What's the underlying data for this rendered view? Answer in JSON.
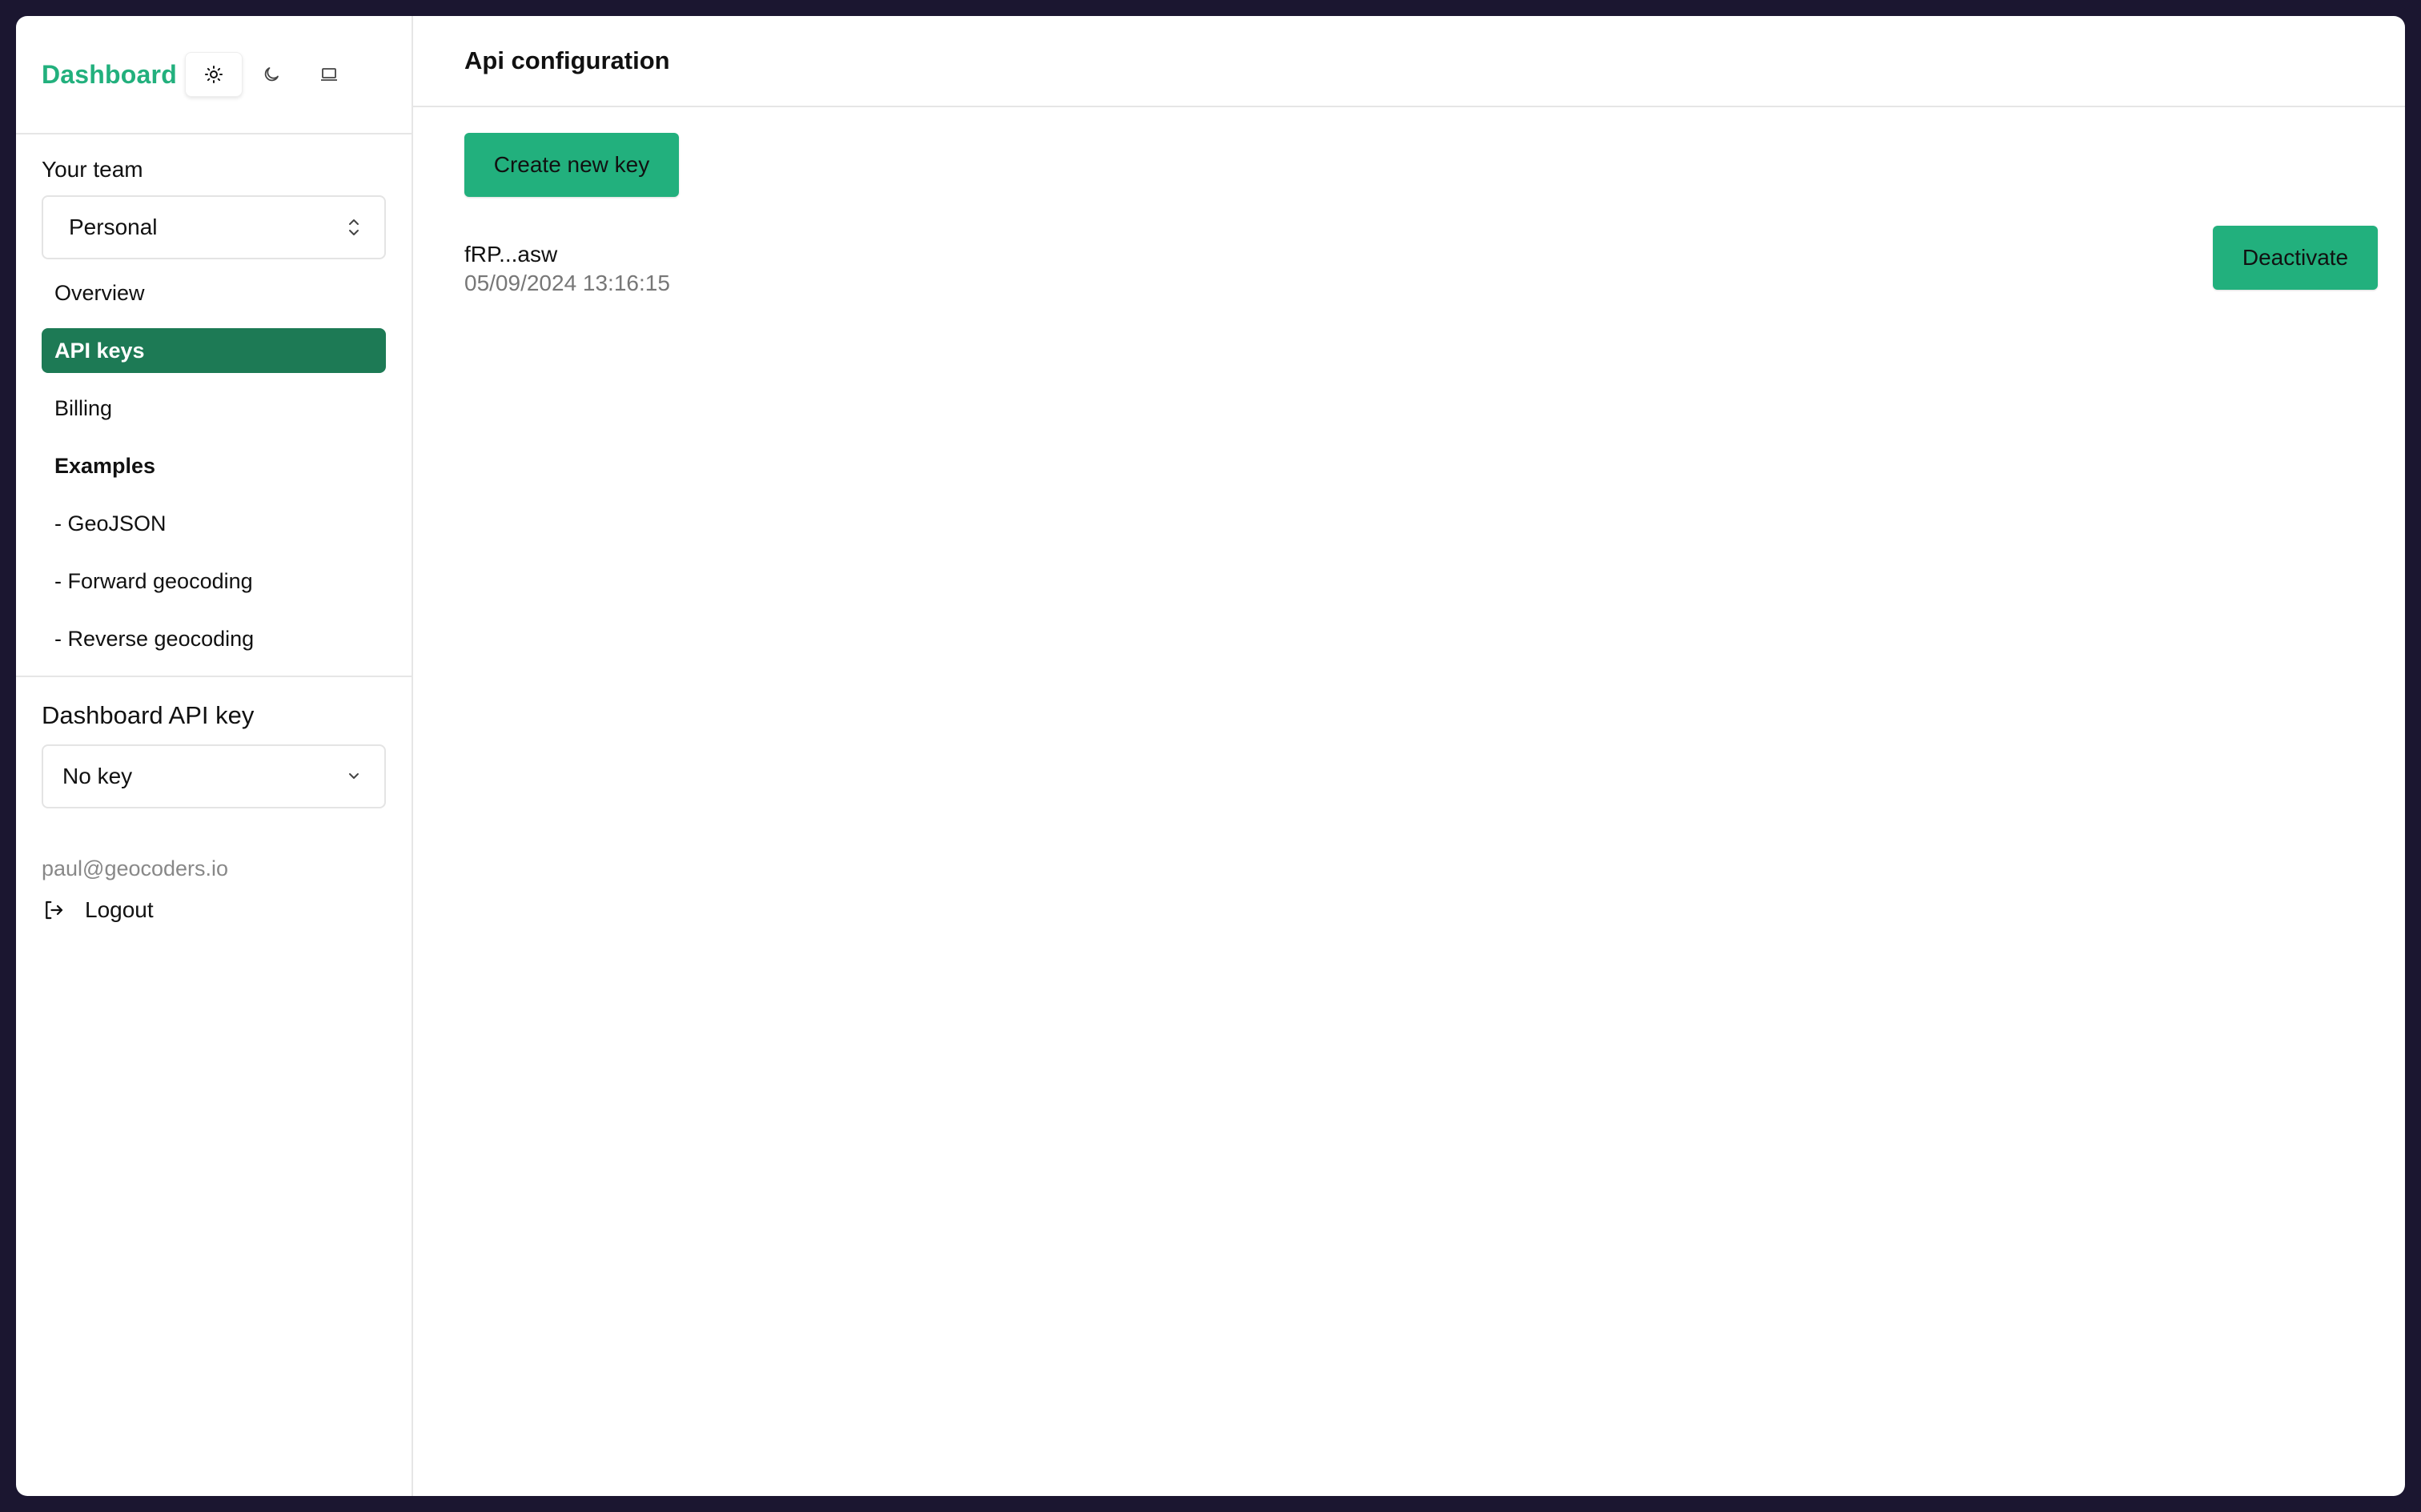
{
  "sidebar": {
    "brand": "Dashboard",
    "theme_icons": [
      "sun-icon",
      "moon-icon",
      "laptop-icon"
    ],
    "team_label": "Your team",
    "team_value": "Personal",
    "nav": [
      {
        "label": "Overview"
      },
      {
        "label": "API keys",
        "active": true
      },
      {
        "label": "Billing"
      },
      {
        "label": "Examples",
        "heading": true
      },
      {
        "label": "- GeoJSON"
      },
      {
        "label": "- Forward geocoding"
      },
      {
        "label": "- Reverse geocoding"
      }
    ],
    "dashboard_key_label": "Dashboard API key",
    "dashboard_key_value": "No key",
    "email": "paul@geocoders.io",
    "logout_label": "Logout"
  },
  "main": {
    "title": "Api configuration",
    "create_label": "Create new key",
    "keys": [
      {
        "name": "fRP...asw",
        "date": "05/09/2024 13:16:15",
        "action": "Deactivate"
      }
    ]
  },
  "colors": {
    "accent": "#22b07d",
    "active_nav": "#1d7a55",
    "border": "#e6e6e6"
  }
}
